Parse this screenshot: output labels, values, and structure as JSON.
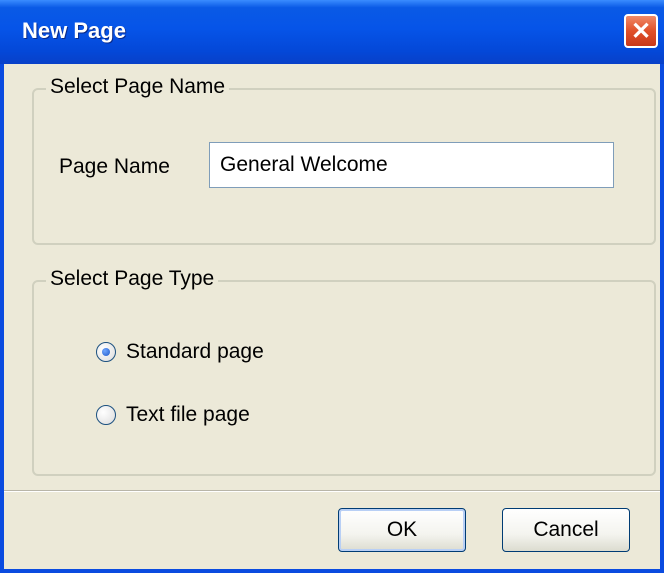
{
  "dialog": {
    "title": "New Page",
    "close_glyph": "✕"
  },
  "name_group": {
    "legend": "Select Page Name",
    "field_label": "Page Name",
    "field_value": "General Welcome"
  },
  "type_group": {
    "legend": "Select Page Type",
    "options": [
      {
        "label": "Standard page",
        "selected": true
      },
      {
        "label": "Text file page",
        "selected": false
      }
    ]
  },
  "buttons": {
    "ok": "OK",
    "cancel": "Cancel"
  }
}
